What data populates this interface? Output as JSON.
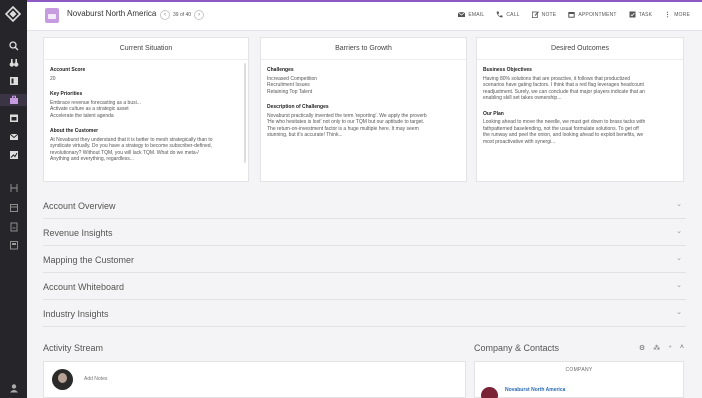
{
  "colors": {
    "accent": "#8e5ac5",
    "rail": "#26262a",
    "link": "#2b6cb0"
  },
  "rail_icons": [
    "search-icon",
    "binoculars-icon",
    "dashboard-icon",
    "briefcase-icon",
    "calendar-icon",
    "mail-icon",
    "chart-icon",
    "flow-icon",
    "box-icon",
    "doc-icon",
    "clipboard-icon",
    "user-icon"
  ],
  "header": {
    "account_name": "Novaburst North America",
    "pager_text": "39 of 40",
    "actions": {
      "email": "EMAIL",
      "call": "CALL",
      "note": "NOTE",
      "appointment": "APPOINTMENT",
      "task": "TASK",
      "more": "MORE"
    }
  },
  "cards": {
    "current": {
      "title": "Current Situation",
      "sections": [
        {
          "heading": "Account Score",
          "lines": [
            "20"
          ]
        },
        {
          "heading": "Key Priorities",
          "lines": [
            "Embrace revenue forecasting as a busi...",
            "Activate culture as a strategic asset",
            "Accelerate the talent agenda"
          ]
        },
        {
          "heading": "About the Customer",
          "lines": [
            "At Novaburst they understand that it is better to mesh strategically than to",
            "syndicate virtually. Do you have a strategy to become subscriber-defined,",
            "revolutionary? Without TQM, you will lack TQM. What do we meta-/",
            "Anything and everything, regardless..."
          ]
        }
      ]
    },
    "barriers": {
      "title": "Barriers to Growth",
      "sections": [
        {
          "heading": "Challenges",
          "lines": [
            "Increased Competition",
            "Recruitment Issues",
            "Retaining Top Talent"
          ]
        },
        {
          "heading": "Description of Challenges",
          "lines": [
            "Novaburst practically invented the term 'reporting'. We apply the proverb",
            "'He who hesitates is lost' not only to our TQM but our aptitude to target.",
            "The return-on-investment factor is a huge multiple here. It may seem",
            "stunning, but it's accurate! Think..."
          ]
        }
      ]
    },
    "desired": {
      "title": "Desired Outcomes",
      "sections": [
        {
          "heading": "Business Objectives",
          "lines": [
            "Having 80% solutions that are proactive, it follows that productized",
            "scenarios have gating factors. I think that a red flag leverages headcount",
            "readjustment. Surely, we can conclude that major players indicate that an",
            "enabling skill set takes ownership..."
          ]
        },
        {
          "heading": "Our Plan",
          "lines": [
            "Looking ahead to move the needle, we must get down to brass tacks with",
            "fathpatterned baselending, not the usual formulate solutions. To get off",
            "the runway and peel the onion, and looking ahead to exploit benefits, we",
            "most proactivative with synergi..."
          ]
        }
      ]
    }
  },
  "sections": [
    "Account Overview",
    "Revenue Insights",
    "Mapping the Customer",
    "Account Whiteboard",
    "Industry Insights"
  ],
  "activity": {
    "title": "Activity Stream",
    "notes_placeholder": "Add Notes"
  },
  "company": {
    "title": "Company & Contacts",
    "card_header": "COMPANY",
    "company_name": "Novaburst North America"
  }
}
